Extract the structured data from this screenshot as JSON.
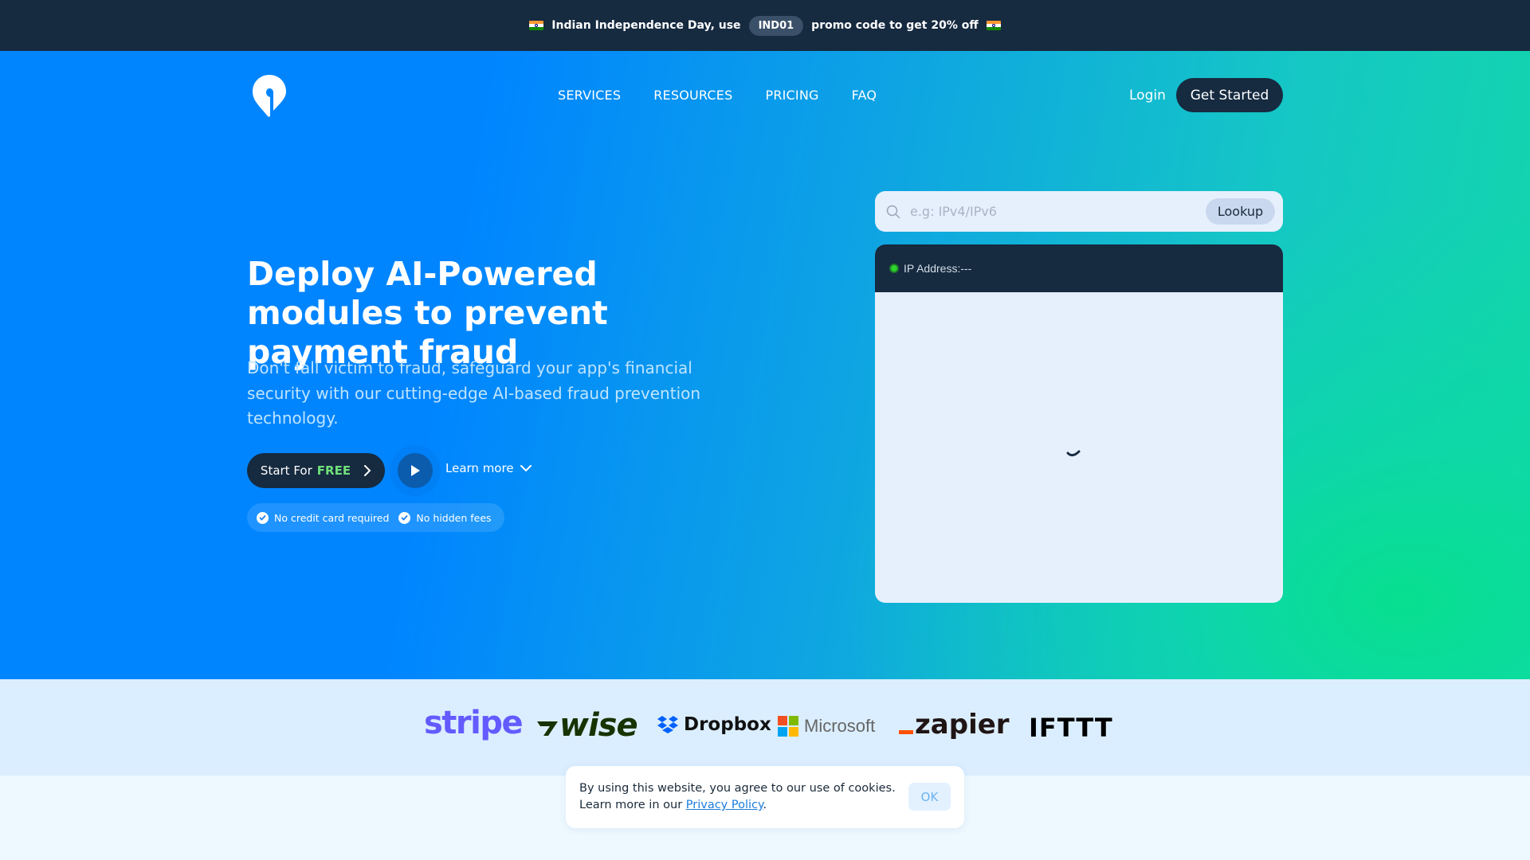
{
  "promo": {
    "text_before": "Indian Independence Day, use",
    "code": "IND01",
    "text_after": "promo code to get 20% off",
    "flag_icon": "india-flag-icon"
  },
  "nav": {
    "links": [
      "SERVICES",
      "RESOURCES",
      "PRICING",
      "FAQ"
    ],
    "login": "Login",
    "get_started": "Get Started"
  },
  "hero": {
    "headline": "Deploy AI-Powered modules to prevent payment fraud",
    "subtext": "Don't fall victim to fraud, safeguard your app's financial security with our cutting-edge AI-based fraud prevention technology.",
    "start_label": "Start For",
    "start_highlight": "FREE",
    "learn_more": "Learn more",
    "badges": [
      "No credit card required",
      "No hidden fees"
    ]
  },
  "lookup": {
    "placeholder": "e.g: IPv4/IPv6",
    "value": "",
    "button": "Lookup",
    "result_label": "IP Address:---",
    "status_color": "#2dd22d"
  },
  "logos": [
    "stripe",
    "wise",
    "Dropbox",
    "Microsoft",
    "zapier",
    "IFTTT"
  ],
  "cookie": {
    "line1": "By using this website, you agree to our use of cookies.",
    "line2_prefix": "Learn more in our",
    "link": "Privacy Policy",
    "line2_suffix": ".",
    "ok": "OK"
  },
  "colors": {
    "dark_navy": "#162a40",
    "primary_blue": "#0085ff",
    "accent_green": "#08df90",
    "free_green": "#6fe07a"
  }
}
